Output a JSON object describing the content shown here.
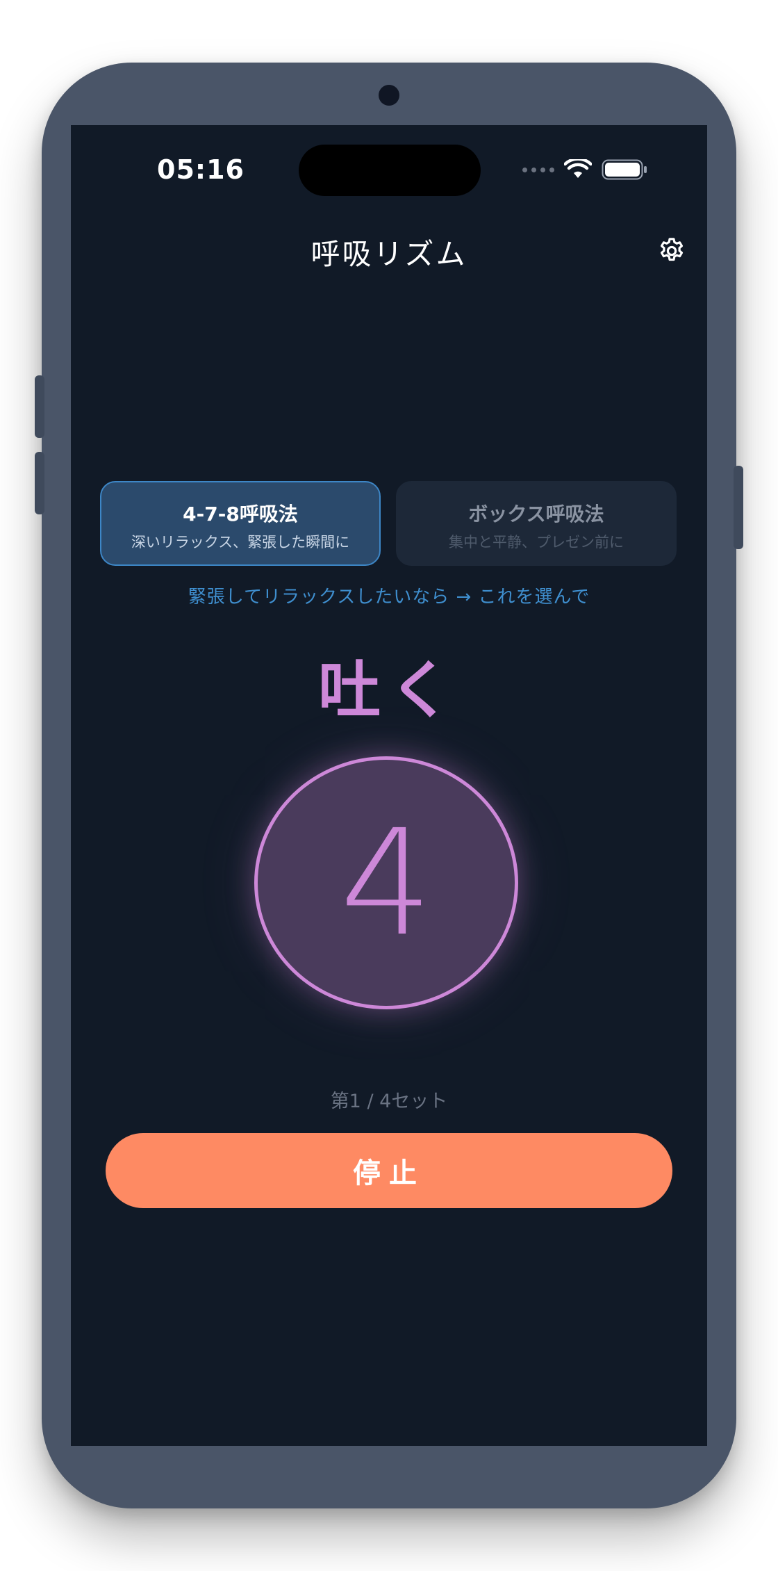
{
  "status_bar": {
    "time": "05:16",
    "wifi_icon": "wifi-icon",
    "battery_icon": "battery-icon"
  },
  "header": {
    "title": "呼吸リズム",
    "settings_icon": "gear-icon"
  },
  "modes": [
    {
      "name": "4-7-8呼吸法",
      "description": "深いリラックス、緊張した瞬間に",
      "selected": true
    },
    {
      "name": "ボックス呼吸法",
      "description": "集中と平静、プレゼン前に",
      "selected": false
    }
  ],
  "hint": "緊張してリラックスしたいなら → これを選んで",
  "session": {
    "phase": "吐く",
    "countdown": "4",
    "set_counter": "第1 / 4セット"
  },
  "stop_label": "停止",
  "colors": {
    "background": "#111a27",
    "accent_blue": "#3d86c6",
    "phase_purple": "#cd88d8",
    "stop_orange": "#fe8a63"
  }
}
